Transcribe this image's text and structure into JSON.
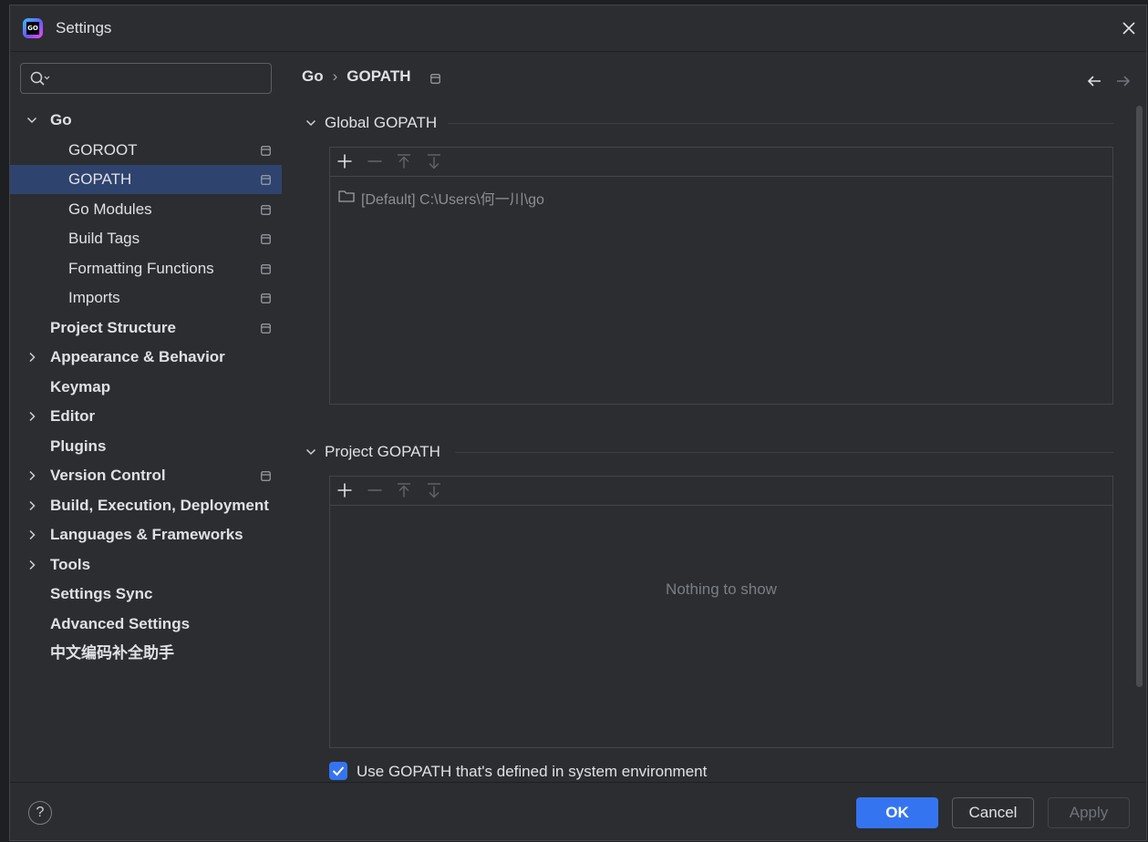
{
  "window": {
    "title": "Settings"
  },
  "search": {
    "placeholder": "",
    "value": ""
  },
  "tree": [
    {
      "label": "Go",
      "level": 0,
      "bold": true,
      "expanded": true,
      "has_chevron": true,
      "project": false,
      "selected": false
    },
    {
      "label": "GOROOT",
      "level": 1,
      "bold": false,
      "has_chevron": false,
      "project": true,
      "selected": false
    },
    {
      "label": "GOPATH",
      "level": 1,
      "bold": false,
      "has_chevron": false,
      "project": true,
      "selected": true
    },
    {
      "label": "Go Modules",
      "level": 1,
      "bold": false,
      "has_chevron": false,
      "project": true,
      "selected": false
    },
    {
      "label": "Build Tags",
      "level": 1,
      "bold": false,
      "has_chevron": false,
      "project": true,
      "selected": false
    },
    {
      "label": "Formatting Functions",
      "level": 1,
      "bold": false,
      "has_chevron": false,
      "project": true,
      "selected": false
    },
    {
      "label": "Imports",
      "level": 1,
      "bold": false,
      "has_chevron": false,
      "project": true,
      "selected": false
    },
    {
      "label": "Project Structure",
      "level": 0,
      "bold": true,
      "has_chevron": false,
      "project": true,
      "selected": false
    },
    {
      "label": "Appearance & Behavior",
      "level": 0,
      "bold": true,
      "expanded": false,
      "has_chevron": true,
      "project": false,
      "selected": false
    },
    {
      "label": "Keymap",
      "level": 0,
      "bold": true,
      "has_chevron": false,
      "project": false,
      "selected": false
    },
    {
      "label": "Editor",
      "level": 0,
      "bold": true,
      "expanded": false,
      "has_chevron": true,
      "project": false,
      "selected": false
    },
    {
      "label": "Plugins",
      "level": 0,
      "bold": true,
      "has_chevron": false,
      "project": false,
      "selected": false
    },
    {
      "label": "Version Control",
      "level": 0,
      "bold": true,
      "expanded": false,
      "has_chevron": true,
      "project": true,
      "selected": false
    },
    {
      "label": "Build, Execution, Deployment",
      "level": 0,
      "bold": true,
      "expanded": false,
      "has_chevron": true,
      "project": false,
      "selected": false
    },
    {
      "label": "Languages & Frameworks",
      "level": 0,
      "bold": true,
      "expanded": false,
      "has_chevron": true,
      "project": false,
      "selected": false
    },
    {
      "label": "Tools",
      "level": 0,
      "bold": true,
      "expanded": false,
      "has_chevron": true,
      "project": false,
      "selected": false
    },
    {
      "label": "Settings Sync",
      "level": 0,
      "bold": true,
      "has_chevron": false,
      "project": false,
      "selected": false
    },
    {
      "label": "Advanced Settings",
      "level": 0,
      "bold": true,
      "has_chevron": false,
      "project": false,
      "selected": false
    },
    {
      "label": "中文编码补全助手",
      "level": 0,
      "bold": true,
      "has_chevron": false,
      "project": false,
      "selected": false
    }
  ],
  "breadcrumb": {
    "parent": "Go",
    "separator": "›",
    "current": "GOPATH"
  },
  "global_section": {
    "title": "Global GOPATH",
    "entries": [
      "[Default] C:\\Users\\何一川\\go"
    ]
  },
  "project_section": {
    "title": "Project GOPATH",
    "empty_text": "Nothing to show"
  },
  "use_system_env": {
    "label": "Use GOPATH that's defined in system environment",
    "checked": true
  },
  "footer": {
    "help": "?",
    "ok": "OK",
    "cancel": "Cancel",
    "apply": "Apply"
  },
  "colors": {
    "accent": "#3574f0",
    "selection": "#2e436e",
    "background": "#2b2d30",
    "text": "#dfe1e5"
  }
}
